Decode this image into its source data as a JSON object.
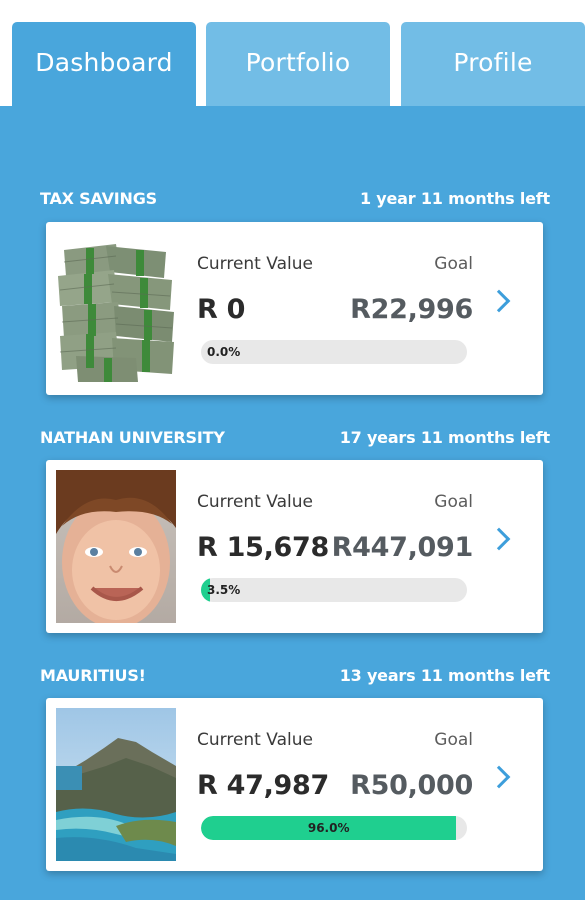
{
  "tabs": [
    {
      "label": "Dashboard",
      "active": true
    },
    {
      "label": "Portfolio",
      "active": false
    },
    {
      "label": "Profile",
      "active": false
    }
  ],
  "goals": [
    {
      "name": "TAX SAVINGS",
      "time_left": "1 year 11 months left",
      "current_label": "Current Value",
      "goal_label": "Goal",
      "current_value": "R 0",
      "goal_value": "R22,996",
      "progress_text": "0.0%",
      "progress": 0.0,
      "image": "stack-of-cash"
    },
    {
      "name": "NATHAN UNIVERSITY",
      "time_left": "17 years 11 months left",
      "current_label": "Current Value",
      "goal_label": "Goal",
      "current_value": "R 15,678",
      "goal_value": "R447,091",
      "progress_text": "3.5%",
      "progress": 0.035,
      "image": "smiling-boy-portrait"
    },
    {
      "name": "MAURITIUS!",
      "time_left": "13 years 11 months left",
      "current_label": "Current Value",
      "goal_label": "Goal",
      "current_value": "R 47,987",
      "goal_value": "R50,000",
      "progress_text": "96.0%",
      "progress": 0.96,
      "image": "mountain-coastline"
    }
  ],
  "colors": {
    "background": "#49a6dc",
    "tab_inactive": "#72bde6",
    "progress": "#1fcf8f",
    "chevron": "#3d9edb"
  }
}
